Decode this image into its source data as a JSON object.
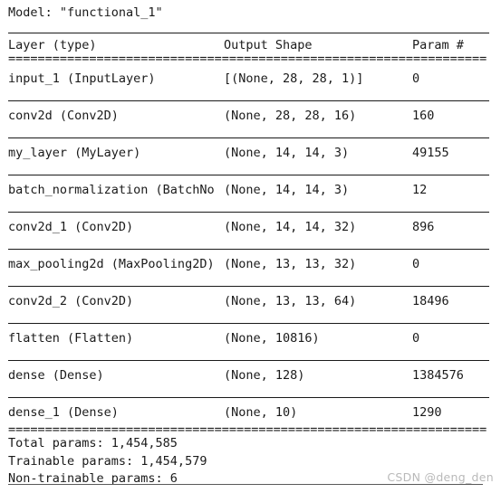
{
  "model": {
    "title": "Model: \"functional_1\""
  },
  "table": {
    "headers": {
      "layer": "Layer (type)",
      "output_shape": "Output Shape",
      "param": "Param #"
    },
    "separator_equals": "=================================================================",
    "rows": [
      {
        "layer": "input_1 (InputLayer)",
        "output_shape": "[(None, 28, 28, 1)]",
        "param": "0"
      },
      {
        "layer": "conv2d (Conv2D)",
        "output_shape": "(None, 28, 28, 16)",
        "param": "160"
      },
      {
        "layer": "my_layer (MyLayer)",
        "output_shape": "(None, 14, 14, 3)",
        "param": "49155"
      },
      {
        "layer": "batch_normalization (BatchNo",
        "output_shape": "(None, 14, 14, 3)",
        "param": "12"
      },
      {
        "layer": "conv2d_1 (Conv2D)",
        "output_shape": "(None, 14, 14, 32)",
        "param": "896"
      },
      {
        "layer": "max_pooling2d (MaxPooling2D)",
        "output_shape": "(None, 13, 13, 32)",
        "param": "0"
      },
      {
        "layer": "conv2d_2 (Conv2D)",
        "output_shape": "(None, 13, 13, 64)",
        "param": "18496"
      },
      {
        "layer": "flatten (Flatten)",
        "output_shape": "(None, 10816)",
        "param": "0"
      },
      {
        "layer": "dense (Dense)",
        "output_shape": "(None, 128)",
        "param": "1384576"
      },
      {
        "layer": "dense_1 (Dense)",
        "output_shape": "(None, 10)",
        "param": "1290"
      }
    ]
  },
  "footer": {
    "total_params": "Total params: 1,454,585",
    "trainable_params": "Trainable params: 1,454,579",
    "non_trainable_params": "Non-trainable params: 6"
  },
  "watermark": {
    "text": "CSDN @deng_den"
  }
}
